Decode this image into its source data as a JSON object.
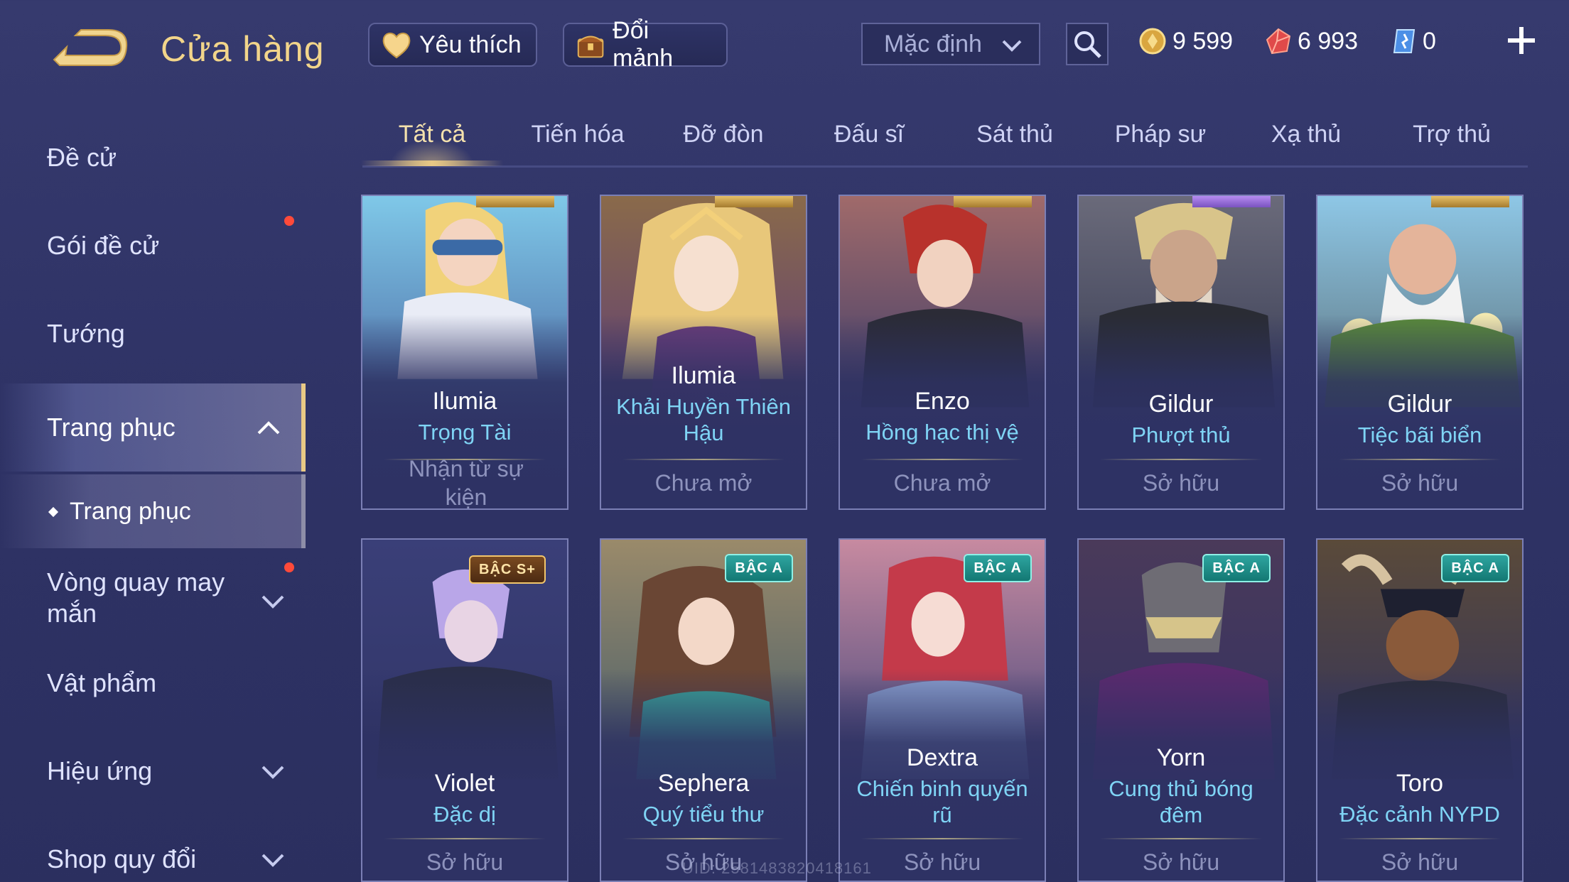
{
  "header": {
    "title": "Cửa hàng",
    "favorite_label": "Yêu thích",
    "exchange_label": "Đổi mảnh",
    "sort_selected": "Mặc định",
    "currencies": [
      {
        "name": "gold-coin",
        "value": "9 599"
      },
      {
        "name": "ruby",
        "value": "6 993"
      },
      {
        "name": "voucher",
        "value": "0"
      }
    ]
  },
  "sidebar": {
    "items": [
      {
        "label": "Đề cử"
      },
      {
        "label": "Gói đề cử"
      },
      {
        "label": "Tướng"
      },
      {
        "label": "Trang phục"
      },
      {
        "label": "Vòng quay may mắn"
      },
      {
        "label": "Vật phẩm"
      },
      {
        "label": "Hiệu ứng"
      },
      {
        "label": "Shop quy đổi"
      }
    ],
    "sub_item": "Trang phục"
  },
  "tabs": [
    "Tất cả",
    "Tiến hóa",
    "Đỡ đòn",
    "Đấu sĩ",
    "Sát thủ",
    "Pháp sư",
    "Xạ thủ",
    "Trợ thủ"
  ],
  "cards": [
    {
      "hero": "Ilumia",
      "skin": "Trọng Tài",
      "status": "Nhận từ sự kiện",
      "tier": ""
    },
    {
      "hero": "Ilumia",
      "skin": "Khải Huyền Thiên Hậu",
      "status": "Chưa mở",
      "tier": ""
    },
    {
      "hero": "Enzo",
      "skin": "Hồng hạc thị vệ",
      "status": "Chưa mở",
      "tier": ""
    },
    {
      "hero": "Gildur",
      "skin": "Phượt thủ",
      "status": "Sở hữu",
      "tier": ""
    },
    {
      "hero": "Gildur",
      "skin": "Tiệc bãi biển",
      "status": "Sở hữu",
      "tier": ""
    },
    {
      "hero": "Violet",
      "skin": "Đặc dị",
      "status": "Sở hữu",
      "tier": "BẬC S+"
    },
    {
      "hero": "Sephera",
      "skin": "Quý tiểu thư",
      "status": "Sở hữu",
      "tier": "BẬC A"
    },
    {
      "hero": "Dextra",
      "skin": "Chiến binh quyến rũ",
      "status": "Sở hữu",
      "tier": "BẬC A"
    },
    {
      "hero": "Yorn",
      "skin": "Cung thủ bóng đêm",
      "status": "Sở hữu",
      "tier": "BẬC A"
    },
    {
      "hero": "Toro",
      "skin": "Đặc cảnh NYPD",
      "status": "Sở hữu",
      "tier": "BẬC A"
    }
  ],
  "watermark": "UID: 2581483820418161",
  "colors": {
    "accent_gold": "#e9c985",
    "skin_name": "#7fd4f5",
    "tier_teal": "#2ea5a0",
    "notification": "#ff4a3a"
  }
}
